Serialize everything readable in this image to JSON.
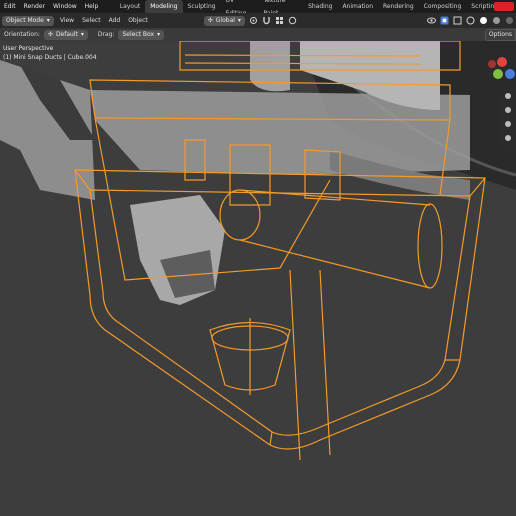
{
  "topbar": {
    "menus": [
      "Edit",
      "Render",
      "Window",
      "Help"
    ],
    "tabs": [
      "Layout",
      "Modeling",
      "Sculpting",
      "UV Editing",
      "Texture Paint",
      "Shading",
      "Animation",
      "Rendering",
      "Compositing",
      "Scripting"
    ],
    "active_tab": "Modeling",
    "add_tab": "+"
  },
  "header": {
    "mode": "Object Mode",
    "menus": [
      "View",
      "Select",
      "Add",
      "Object"
    ],
    "transform_orientation": "Global"
  },
  "toolbar": {
    "orientation_label": "Orientation:",
    "orientation_value": "Default",
    "drag_label": "Drag:",
    "drag_value": "Select Box",
    "options_label": "Options"
  },
  "viewport": {
    "perspective": "User Perspective",
    "selection": "(1) Mini Snap Ducts | Cube.004"
  },
  "colors": {
    "background": "#3d3d3d",
    "selected_wire": "#f39a2a",
    "solid_body": "#8a8a8a",
    "axis_x": "#e2433f",
    "axis_y": "#7fbf3f",
    "axis_z": "#4a7fe0",
    "tab_active": "#3d3d3d"
  },
  "icons": {
    "editor_type": "cube-icon",
    "pivot": "pivot-icon",
    "snap": "magnet-icon",
    "proportional": "circle-icon",
    "gizmo": "axis-gizmo-icon",
    "overlay": "overlay-icon",
    "shading": "shading-sphere-icon"
  }
}
